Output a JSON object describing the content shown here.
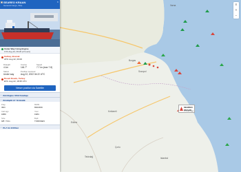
{
  "vessel": {
    "name": "SEAREO KRAAN",
    "type": "General Cargo, Ship"
  },
  "status": {
    "label": "Under Way Using Engine",
    "time": "17th Aug 22, 09:20 (2 hours)"
  },
  "departure": {
    "label": "Gulbey, Bosnak",
    "name": "ATD: Aug 22, 09:00"
  },
  "stats": [
    {
      "label": "Draught",
      "value": "4.1m"
    },
    {
      "label": "Course",
      "value": "146.7°"
    },
    {
      "label": "Speed",
      "value": "7.7 kn (max 7.8)"
    }
  ],
  "status_row": {
    "label": "Status",
    "value": "Under way",
    "updated_label": "Position received",
    "updated_value": "Aug 22, 2022 04:22 UTC"
  },
  "arrival": {
    "label": "Roseti Roads, Turkey",
    "name": "ETA: Aug 22, 18:35 UTC"
  },
  "satellite_button": "Newer position via Satellite",
  "sections": [
    "ПОСЛЕДНА ПРИСТАНИЩА",
    "ПОЗИЦИЯ ОТ ТЕЧЕНИЕ"
  ],
  "voyage_section": "ПЪТ НА КОРАБА",
  "details": [
    {
      "k": "Flag",
      "v": "IMO"
    },
    {
      "k": "MMSI",
      "v": "8302369"
    },
    {
      "k": "Call sign",
      "v": "1880"
    },
    {
      "k": "Year",
      "v": "1984"
    },
    {
      "k": "Size",
      "v": "9/8 / 74m"
    },
    {
      "k": "Built",
      "v": "TÜRKMEN"
    }
  ],
  "popup": {
    "name": "SEAREO KRAAN",
    "time": "1 hour ago"
  },
  "map": {
    "cities": [
      "Varna",
      "Burgas",
      "Edirne",
      "Kırklareli",
      "Istanbul",
      "Sozopol",
      "Tekirdağ",
      "Çorlu"
    ]
  },
  "colors": {
    "accent": "#1f64c0",
    "sea": "#a9c9e6",
    "land": "#eef0ea",
    "vessel": "#d9453b"
  }
}
